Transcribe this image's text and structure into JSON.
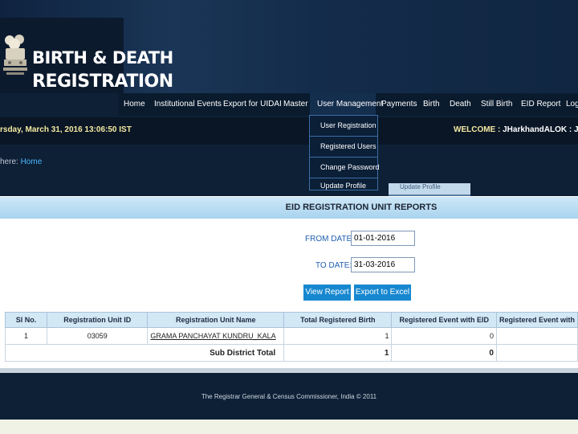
{
  "colors": {
    "header_dark": "#0d2036",
    "accent_blue": "#1788d0",
    "menu_text": "#f4e9a0",
    "link": "#4db7ff"
  },
  "header": {
    "title_line1": "BIRTH & DEATH",
    "title_line2": "REGISTRATION",
    "emblem_icon": "national-emblem-icon"
  },
  "nav": {
    "items": [
      {
        "label": "Home"
      },
      {
        "label": "Institutional Events"
      },
      {
        "label": "Export for UIDAI"
      },
      {
        "label": "Master"
      },
      {
        "label": "User Management"
      },
      {
        "label": "Payments"
      },
      {
        "label": "Birth"
      },
      {
        "label": "Death"
      },
      {
        "label": "Still Birth"
      },
      {
        "label": "EID Report"
      },
      {
        "label": "Logo"
      }
    ]
  },
  "dropdown": {
    "items": [
      {
        "label": "User Registration"
      },
      {
        "label": "Registered Users"
      },
      {
        "label": "Change Password"
      },
      {
        "label": "Update Profile"
      }
    ],
    "ghost_label": "Update Profile"
  },
  "infobar": {
    "datetime": "rsday, March 31, 2016 13:06:50 IST",
    "welcome_label": "WELCOME :",
    "welcome_user": "JHarkhandALOK : JH - (Registra"
  },
  "breadcrumb": {
    "prefix": "here:",
    "home": "Home"
  },
  "report": {
    "title": "EID REGISTRATION UNIT REPORTS",
    "from_label": "FROM DATE:",
    "from_value": "01-01-2016",
    "to_label": "TO DATE:",
    "to_value": "31-03-2016",
    "view_button": "View Report",
    "export_button": "Export to Excel"
  },
  "table": {
    "headers": [
      "Sl No.",
      "Registration Unit ID",
      "Registration Unit Name",
      "Total Registered Birth",
      "Registered Event with EID",
      "Registered Event with"
    ],
    "rows": [
      {
        "sl": "1",
        "unit_id": "03059",
        "unit_name": "GRAMA PANCHAYAT KUNDRU_KALA",
        "total_birth": "1",
        "with_eid": "0"
      }
    ],
    "total_label": "Sub District Total",
    "total_birth": "1",
    "total_with_eid": "0"
  },
  "footer": {
    "text": "The Registrar General & Census Commissioner, India © 2011"
  }
}
